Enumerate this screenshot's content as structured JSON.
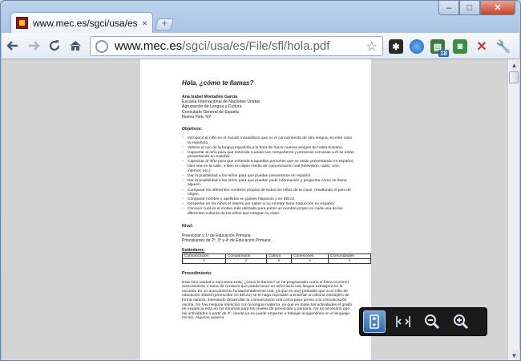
{
  "browser": {
    "tab_title": "www.mec.es/sgci/usa/es...",
    "tab_close": "×",
    "window_controls": {
      "minimize": "–",
      "maximize": "□",
      "close": "✕"
    },
    "url_host": "www.mec.es",
    "url_path": "/sgci/usa/es/File/sfl/hola.pdf",
    "extension_badge": "18"
  },
  "pdf": {
    "title": "Hola, ¿cómo te llamas?",
    "author_lines": [
      "Ana Isabel Montañés García",
      "Escuela Internacional de Naciones Unidas",
      "Agrupación de Lengua y Cultura",
      "Consulado General de España",
      "Nueva York, NY"
    ],
    "objectives_heading": "Objetivos:",
    "objectives": [
      "Introducir al niño en el mundo maravilloso que es el conocimiento de otra lengua, en este caso la española.",
      "Valorar el uso de la lengua española a la hora de hacer nuevos amigos de habla hispana.",
      "Capacitar al niño para que entienda cuando sus compañeros y personas cercanas a él se están presentando en español.",
      "Capacitar al niño para que entienda a aquellas personas que se están presentando en español, bien sea en la calle, o bien en algún medio de comunicación oral (televisión, radio, cine, internet, etc.)",
      "Dar la posibilidad a los niños para que puedan presentarse en español.",
      "Dar la posibilidad a los niños para que puedan pedir información y preguntar cómo se llama alguien.",
      "Comparar los diferentes nombres propios de todos los niños de la clase, resaltando el país de origen.",
      "Comparar nombre y apellidos en países hispanos y en EEUU.",
      "Despertar en los niños el interés por saber si su nombre tiene traducción en español.",
      "Conocer cuál es el motivo más utilizado para poner un nombre propio en cada una de las diferentes culturas de los niños que integran la clase."
    ],
    "level_heading": "Nivel:",
    "level_lines": [
      "Preescolar y 1º de Educación Primaria",
      "Principiantes de 2º, 3º y 4º de Educación Primaria"
    ],
    "standards_label": "Estándares:",
    "standards_columns": [
      "Comunicación",
      "Comparación",
      "Cultura",
      "Conexiones",
      "Comunidades"
    ],
    "standards_marks": [
      "x",
      "x",
      "x",
      "x",
      "x"
    ],
    "procedure_heading": "Procedimiento:",
    "procedure_text": "Esta mini-unidad o mini-tema Hola, ¿cómo te llamas? se ha programado como si fuera el primer acercamiento o toma de contacto que puede tener un niño hacia una lengua extranjera en la escuela. Es un acercamiento fundamentalmente oral, ya que es muy probable que a un niño de educación infantil (preescolar en EEUU) se le haga imposible a enseñar un idioma extranjero de forma natural. Intentando desarrollar la comunicación oral como paso previo a la comunicación escrita. No hay ninguna intención con la lengua materna, ya que en todas las actividades el grado de exigencia está en las mínimas para los niveles de preescolar y primaria. No es necesario que las actividades a partir de 2º, donde ya se puede empezar a trabajar acogiéndose en el lenguaje escrito. Algunos autores"
  },
  "icons": {
    "back": "back-arrow-icon",
    "forward": "forward-arrow-icon",
    "reload": "reload-icon",
    "home": "home-icon",
    "star": "star-icon",
    "wrench": "wrench-icon"
  }
}
